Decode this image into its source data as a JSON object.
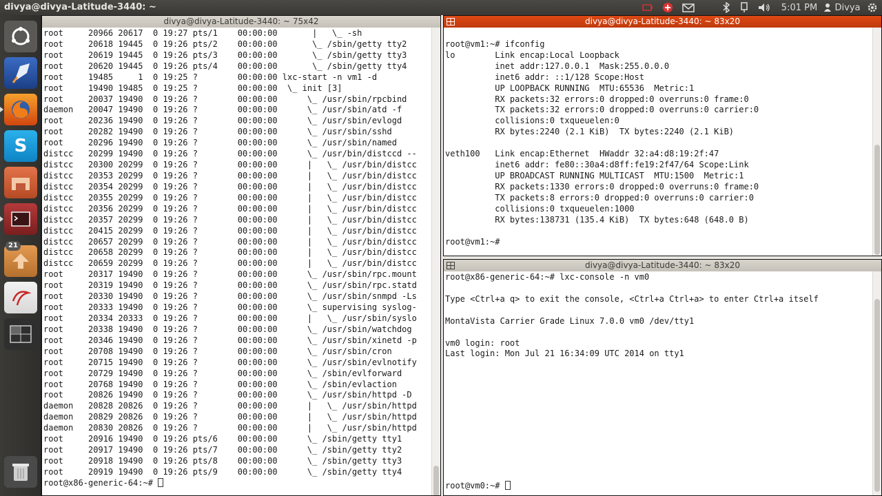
{
  "panel": {
    "title": "divya@divya-Latitude-3440: ~",
    "clock": "5:01 PM",
    "user": "Divya",
    "tray_icons": [
      "battery-icon",
      "network-icon",
      "mail-icon",
      "bluetooth-icon",
      "keyboard-icon",
      "volume-icon"
    ]
  },
  "launcher": {
    "items": [
      {
        "name": "dash-home-icon",
        "color": "#6a6864"
      },
      {
        "name": "rocket-app-icon",
        "color": "#2a5caa"
      },
      {
        "name": "firefox-icon",
        "color": "#e76b1e"
      },
      {
        "name": "skype-icon",
        "color": "#1fa3e0"
      },
      {
        "name": "files-home-icon",
        "color": "#d4643a"
      },
      {
        "name": "terminal-app-icon",
        "color": "#a33030"
      },
      {
        "name": "software-updater-icon",
        "color": "#c8803a",
        "badge": "21"
      },
      {
        "name": "document-app-icon",
        "color": "#c82828"
      },
      {
        "name": "workspace-switcher-icon",
        "color": "#3a3a3a"
      },
      {
        "name": "trash-icon",
        "color": "#5a5a5a"
      }
    ]
  },
  "windows": {
    "left": {
      "title": "divya@divya-Latitude-3440: ~ 75x42",
      "lines": [
        "root     20966 20617  0 19:27 pts/1    00:00:00       |   \\_ -sh",
        "root     20618 19445  0 19:26 pts/2    00:00:00       \\_ /sbin/getty tty2",
        "root     20619 19445  0 19:26 pts/3    00:00:00       \\_ /sbin/getty tty3",
        "root     20620 19445  0 19:26 pts/4    00:00:00       \\_ /sbin/getty tty4",
        "root     19485     1  0 19:25 ?        00:00:00 lxc-start -n vm1 -d",
        "root     19490 19485  0 19:25 ?        00:00:00  \\_ init [3]",
        "root     20037 19490  0 19:26 ?        00:00:00      \\_ /usr/sbin/rpcbind",
        "daemon   20047 19490  0 19:26 ?        00:00:00      \\_ /usr/sbin/atd -f",
        "root     20236 19490  0 19:26 ?        00:00:00      \\_ /usr/sbin/evlogd",
        "root     20282 19490  0 19:26 ?        00:00:00      \\_ /usr/sbin/sshd",
        "root     20296 19490  0 19:26 ?        00:00:00      \\_ /usr/sbin/named",
        "distcc   20299 19490  0 19:26 ?        00:00:00      \\_ /usr/bin/distccd --",
        "distcc   20300 20299  0 19:26 ?        00:00:00      |   \\_ /usr/bin/distcc",
        "distcc   20353 20299  0 19:26 ?        00:00:00      |   \\_ /usr/bin/distcc",
        "distcc   20354 20299  0 19:26 ?        00:00:00      |   \\_ /usr/bin/distcc",
        "distcc   20355 20299  0 19:26 ?        00:00:00      |   \\_ /usr/bin/distcc",
        "distcc   20356 20299  0 19:26 ?        00:00:00      |   \\_ /usr/bin/distcc",
        "distcc   20357 20299  0 19:26 ?        00:00:00      |   \\_ /usr/bin/distcc",
        "distcc   20415 20299  0 19:26 ?        00:00:00      |   \\_ /usr/bin/distcc",
        "distcc   20657 20299  0 19:26 ?        00:00:00      |   \\_ /usr/bin/distcc",
        "distcc   20658 20299  0 19:26 ?        00:00:00      |   \\_ /usr/bin/distcc",
        "distcc   20659 20299  0 19:26 ?        00:00:00      |   \\_ /usr/bin/distcc",
        "root     20317 19490  0 19:26 ?        00:00:00      \\_ /usr/sbin/rpc.mount",
        "root     20319 19490  0 19:26 ?        00:00:00      \\_ /usr/sbin/rpc.statd",
        "root     20330 19490  0 19:26 ?        00:00:00      \\_ /usr/sbin/snmpd -Ls",
        "root     20333 19490  0 19:26 ?        00:00:00      \\_ supervising syslog-",
        "root     20334 20333  0 19:26 ?        00:00:00      |   \\_ /usr/sbin/syslo",
        "root     20338 19490  0 19:26 ?        00:00:00      \\_ /usr/sbin/watchdog",
        "root     20346 19490  0 19:26 ?        00:00:00      \\_ /usr/sbin/xinetd -p",
        "root     20708 19490  0 19:26 ?        00:00:00      \\_ /usr/sbin/cron",
        "root     20715 19490  0 19:26 ?        00:00:00      \\_ /usr/sbin/evlnotify",
        "root     20729 19490  0 19:26 ?        00:00:00      \\_ /sbin/evlforward",
        "root     20768 19490  0 19:26 ?        00:00:00      \\_ /sbin/evlaction",
        "root     20826 19490  0 19:26 ?        00:00:00      \\_ /usr/sbin/httpd -D",
        "daemon   20828 20826  0 19:26 ?        00:00:00      |   \\_ /usr/sbin/httpd",
        "daemon   20829 20826  0 19:26 ?        00:00:00      |   \\_ /usr/sbin/httpd",
        "daemon   20830 20826  0 19:26 ?        00:00:00      |   \\_ /usr/sbin/httpd",
        "root     20916 19490  0 19:26 pts/6    00:00:00      \\_ /sbin/getty tty1",
        "root     20917 19490  0 19:26 pts/7    00:00:00      \\_ /sbin/getty tty2",
        "root     20918 19490  0 19:26 pts/8    00:00:00      \\_ /sbin/getty tty3",
        "root     20919 19490  0 19:26 pts/9    00:00:00      \\_ /sbin/getty tty4"
      ],
      "prompt": "root@x86-generic-64:~# "
    },
    "top_right": {
      "title": "divya@divya-Latitude-3440: ~ 83x20",
      "lines": [
        "",
        "root@vm1:~# ifconfig",
        "lo        Link encap:Local Loopback",
        "          inet addr:127.0.0.1  Mask:255.0.0.0",
        "          inet6 addr: ::1/128 Scope:Host",
        "          UP LOOPBACK RUNNING  MTU:65536  Metric:1",
        "          RX packets:32 errors:0 dropped:0 overruns:0 frame:0",
        "          TX packets:32 errors:0 dropped:0 overruns:0 carrier:0",
        "          collisions:0 txqueuelen:0",
        "          RX bytes:2240 (2.1 KiB)  TX bytes:2240 (2.1 KiB)",
        "",
        "veth100   Link encap:Ethernet  HWaddr 32:a4:d8:19:2f:47",
        "          inet6 addr: fe80::30a4:d8ff:fe19:2f47/64 Scope:Link",
        "          UP BROADCAST RUNNING MULTICAST  MTU:1500  Metric:1",
        "          RX packets:1330 errors:0 dropped:0 overruns:0 frame:0",
        "          TX packets:8 errors:0 dropped:0 overruns:0 carrier:0",
        "          collisions:0 txqueuelen:1000",
        "          RX bytes:138731 (135.4 KiB)  TX bytes:648 (648.0 B)",
        "",
        "root@vm1:~# "
      ]
    },
    "bottom_right": {
      "title": "divya@divya-Latitude-3440: ~ 83x20",
      "lines": [
        "root@x86-generic-64:~# lxc-console -n vm0",
        "",
        "Type <Ctrl+a q> to exit the console, <Ctrl+a Ctrl+a> to enter Ctrl+a itself",
        "",
        "MontaVista Carrier Grade Linux 7.0.0 vm0 /dev/tty1",
        "",
        "vm0 login: root",
        "Last login: Mon Jul 21 16:34:09 UTC 2014 on tty1",
        "",
        "",
        "",
        "",
        "",
        "",
        "",
        "",
        "",
        "",
        ""
      ],
      "prompt": "root@vm0:~# "
    }
  }
}
